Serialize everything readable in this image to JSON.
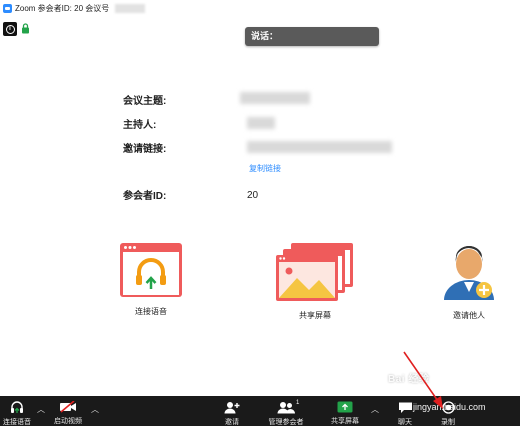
{
  "window": {
    "title": "Zoom 参会者ID: 20   会议号"
  },
  "speaking_bar": {
    "label": "说话："
  },
  "meeting_info": {
    "topic_label": "会议主题:",
    "host_label": "主持人:",
    "invite_link_label": "邀请链接:",
    "copy_link": "复制链接",
    "participant_id_label": "参会者ID:",
    "participant_id_value": "20"
  },
  "actions": [
    {
      "label": "连接语音",
      "icon": "headphones-icon"
    },
    {
      "label": "共享屏幕",
      "icon": "share-screen-icon"
    },
    {
      "label": "邀请他人",
      "icon": "invite-person-icon"
    }
  ],
  "toolbar": {
    "connect_audio": "连接语音",
    "start_video": "启动视频",
    "invite": "邀请",
    "manage_participants": "管理参会者",
    "participant_count": "1",
    "share_screen": "共享屏幕",
    "chat": "聊天",
    "record": "录制"
  },
  "watermark": {
    "main": "Bai 经验",
    "sub": "jingyan.baidu.com"
  },
  "colors": {
    "accent_blue": "#2d8cff",
    "app_red": "#ef5b5b",
    "share_green": "#23a34a",
    "toolbar_bg": "#1a1a1a",
    "arrow_red": "#e02020"
  }
}
